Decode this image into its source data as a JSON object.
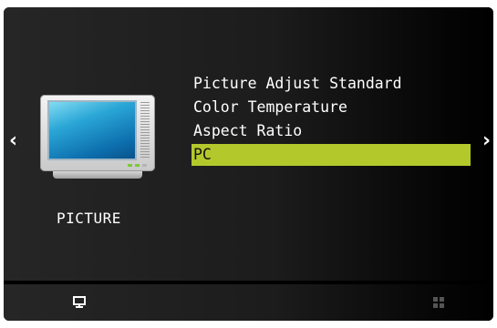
{
  "menu": {
    "category_label": "PICTURE",
    "category_icon": "tv-icon",
    "items": [
      {
        "label": "Picture Adjust",
        "value": "Standard"
      },
      {
        "label": "Color Temperature",
        "value": ""
      },
      {
        "label": "Aspect Ratio",
        "value": ""
      },
      {
        "label": "PC",
        "value": ""
      }
    ],
    "selected_index": 3
  },
  "navigation": {
    "left_arrow": "‹",
    "right_arrow": "›"
  },
  "bottom_bar": {
    "icons": [
      "monitor-icon",
      "grid-icon"
    ]
  },
  "colors": {
    "highlight": "#b3c92b",
    "background": "#1c1c1c",
    "text": "#ffffff"
  }
}
